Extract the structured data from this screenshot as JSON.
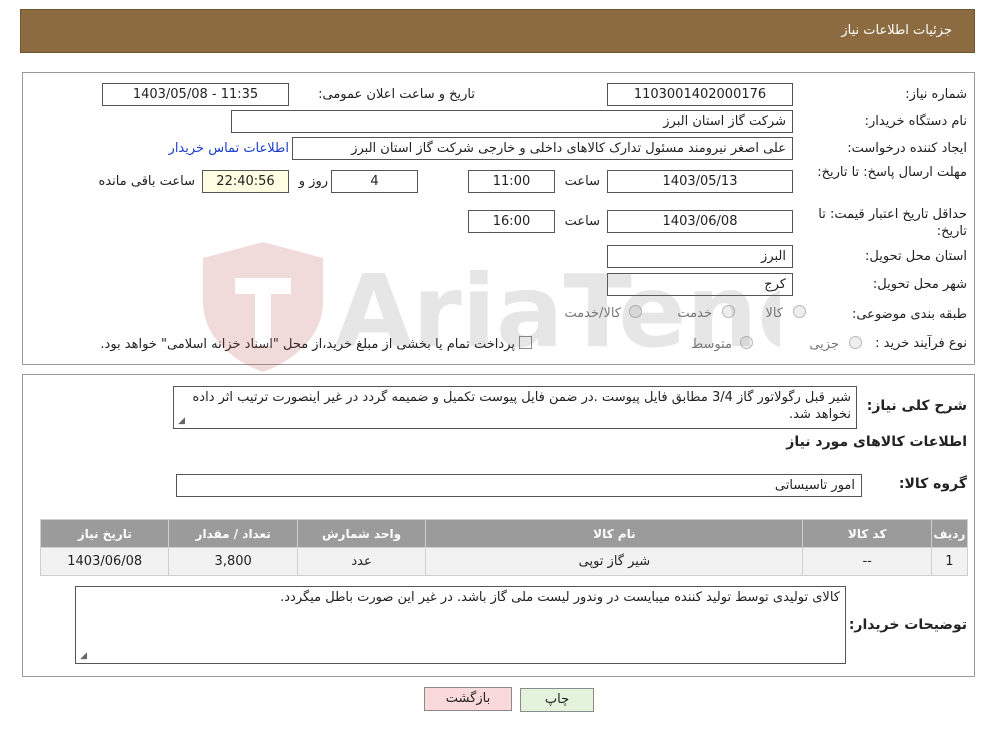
{
  "header": {
    "title": "جزئیات اطلاعات نیاز"
  },
  "fields": {
    "need_number_label": "شماره نیاز:",
    "need_number": "1103001402000176",
    "announce_label": "تاریخ و ساعت اعلان عمومی:",
    "announce_value": "1403/05/08 - 11:35",
    "buyer_org_label": "نام دستگاه خریدار:",
    "buyer_org": "شرکت گاز استان البرز",
    "creator_label": "ایجاد کننده درخواست:",
    "creator": "علی اصغر نیرومند مسئول تدارک کالاهای داخلی و خارجی شرکت گاز استان البرز",
    "contact_link": "اطلاعات تماس خریدار",
    "reply_deadline_label": "مهلت ارسال پاسخ: تا تاریخ:",
    "reply_date": "1403/05/13",
    "time_word": "ساعت",
    "reply_time": "11:00",
    "days_value": "4",
    "days_word": "روز و",
    "remaining_time": "22:40:56",
    "remaining_word": "ساعت باقی مانده",
    "price_valid_label": "حداقل تاریخ اعتبار قیمت: تا تاریخ:",
    "price_valid_date": "1403/06/08",
    "price_valid_time": "16:00",
    "province_label": "استان محل تحویل:",
    "province": "البرز",
    "city_label": "شهر محل تحویل:",
    "city": "کرج",
    "category_label": "طبقه بندی موضوعی:",
    "category_options": [
      "کالا",
      "خدمت",
      "کالا/خدمت"
    ],
    "process_label": "نوع فرآیند خرید :",
    "process_options": [
      "جزیی",
      "متوسط"
    ],
    "process_note": "پرداخت تمام یا بخشی از مبلغ خرید،از محل \"اسناد خزانه اسلامی\" خواهد بود."
  },
  "summary": {
    "label": "شرح کلی نیاز:",
    "text": "شیر قبل رگولاتور گاز 3/4 مطابق فایل پیوست .در ضمن فایل پیوست تکمیل و ضمیمه گردد در غیر اینصورت ترتیب اثر داده نخواهد شد."
  },
  "goods_info_title": "اطلاعات کالاهای مورد نیاز",
  "goods_group": {
    "label": "گروه کالا:",
    "value": "امور تاسیساتی"
  },
  "table": {
    "headers": [
      "ردیف",
      "کد کالا",
      "نام کالا",
      "واحد شمارش",
      "تعداد / مقدار",
      "تاریخ نیاز"
    ],
    "rows": [
      [
        "1",
        "--",
        "شیر گاز توپی",
        "عدد",
        "3,800",
        "1403/06/08"
      ]
    ]
  },
  "buyer_notes": {
    "label": "توضیحات خریدار:",
    "text": "کالای تولیدی توسط تولید کننده میبایست در وندور لیست ملی گاز باشد. در غیر این صورت باطل میگردد."
  },
  "buttons": {
    "print": "چاپ",
    "back": "بازگشت"
  },
  "watermark": {
    "brand": "AriaTender.neT"
  },
  "colors": {
    "header_bg": "#8b6b3f",
    "back_btn_bg": "#f9d9d9",
    "print_btn_bg": "#e4f4dc",
    "link": "#1a3fcc"
  }
}
